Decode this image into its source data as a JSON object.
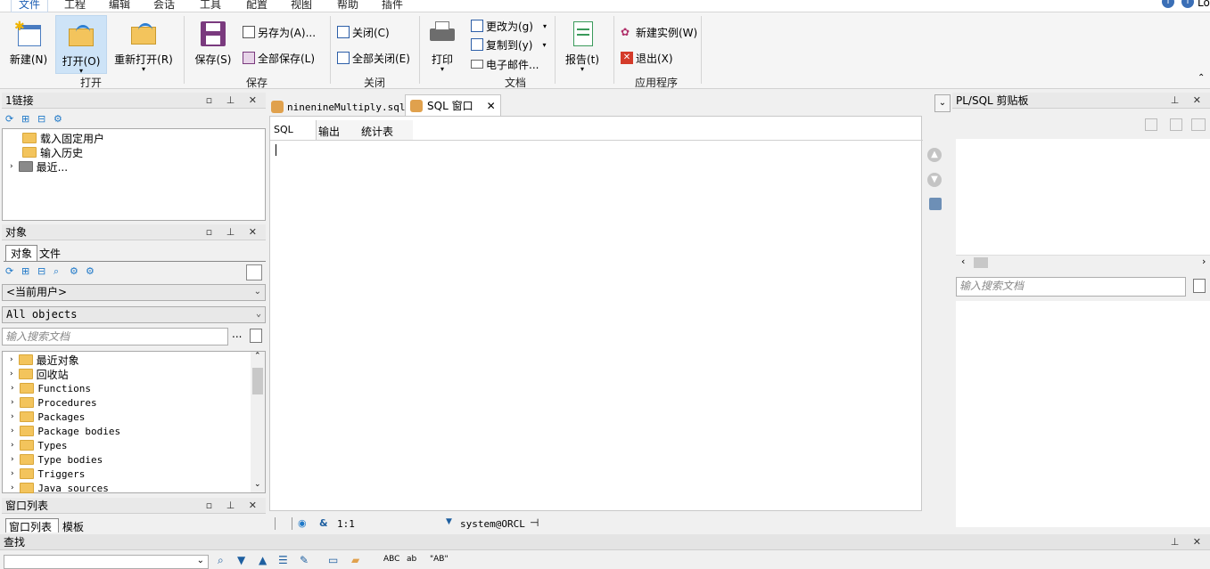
{
  "menu": {
    "items": [
      "文件",
      "工程",
      "编辑",
      "会话",
      "工具",
      "配置",
      "视图",
      "帮助",
      "插件"
    ],
    "right_text": "Lo"
  },
  "ribbon": {
    "open_group": {
      "label": "打开",
      "new": "新建(N)",
      "open": "打开(O)",
      "reopen": "重新打开(R)"
    },
    "save_group": {
      "label": "保存",
      "save": "保存(S)",
      "save_as": "另存为(A)...",
      "save_all": "全部保存(L)"
    },
    "close_group": {
      "label": "关闭",
      "close": "关闭(C)",
      "close_all": "全部关闭(E)"
    },
    "doc_group": {
      "label": "文档",
      "print": "打印",
      "change_to": "更改为(g)",
      "copy_to": "复制到(y)",
      "email": "电子邮件..."
    },
    "report": "报告(t)",
    "app_group": {
      "label": "应用程序",
      "new_instance": "新建实例(W)",
      "exit": "退出(X)"
    }
  },
  "connection_panel": {
    "title": "1链接",
    "tree": [
      "载入固定用户",
      "输入历史",
      "最近..."
    ]
  },
  "objects_panel": {
    "title": "对象",
    "tabs": [
      "对象",
      "文件"
    ],
    "user_select": "<当前用户>",
    "filter_select": "All objects",
    "search_placeholder": "输入搜索文档",
    "more": "...",
    "tree": [
      "最近对象",
      "回收站",
      "Functions",
      "Procedures",
      "Packages",
      "Package bodies",
      "Types",
      "Type bodies",
      "Triggers",
      "Java sources"
    ]
  },
  "window_list_panel": {
    "title": "窗口列表",
    "tabs": [
      "窗口列表",
      "模板"
    ]
  },
  "find_panel": {
    "title": "查找"
  },
  "editor": {
    "tabs": [
      "ninenineMultiply.sql",
      "SQL 窗口"
    ],
    "subtabs": [
      "SQL",
      "输出",
      "统计表"
    ],
    "status": {
      "position": "1:1",
      "connection": "system@ORCL"
    }
  },
  "clipboard_panel": {
    "title": "PL/SQL 剪贴板",
    "search_placeholder": "输入搜索文档"
  },
  "colors": {
    "accent": "#1d5fb4",
    "pressed": "#cde3f7"
  }
}
